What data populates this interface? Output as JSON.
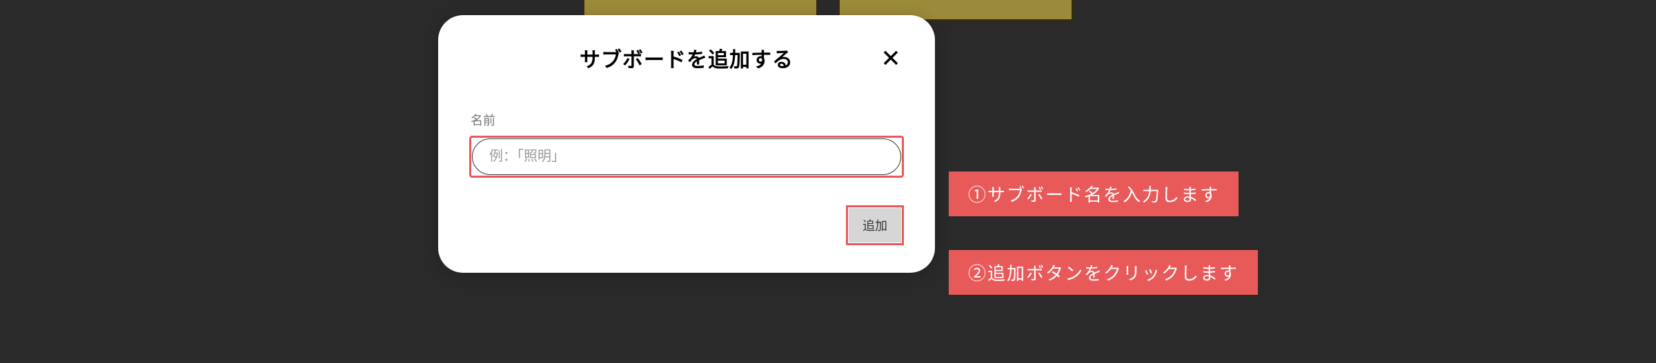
{
  "dialog": {
    "title": "サブボードを追加する",
    "fieldLabel": "名前",
    "inputPlaceholder": "例：「照明」",
    "addButton": "追加"
  },
  "annotations": {
    "step1": "①サブボード名を入力します",
    "step2": "②追加ボタンをクリックします"
  }
}
